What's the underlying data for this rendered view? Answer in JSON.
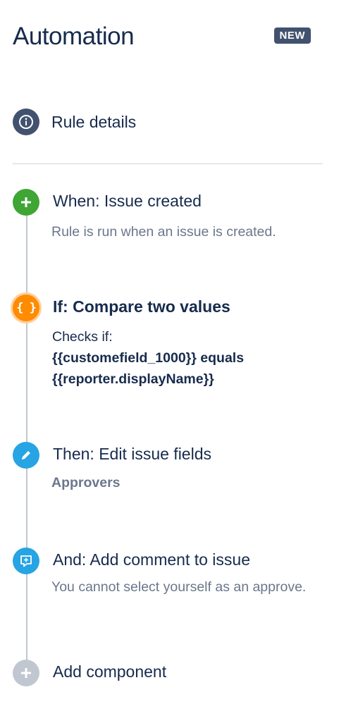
{
  "header": {
    "title": "Automation",
    "badge": "NEW"
  },
  "rule_details": {
    "label": "Rule details",
    "icon": "info-icon"
  },
  "steps": [
    {
      "title": "When: Issue created",
      "description": "Rule is run when an issue is created.",
      "icon": "plus-icon",
      "color": "#3fa535"
    },
    {
      "title": "If: Compare two values",
      "line1": "Checks if:",
      "line2": "{{customefield_1000}} equals",
      "line3": "{{reporter.displayName}}",
      "icon": "braces-icon",
      "color": "#ff8b00"
    },
    {
      "title": "Then: Edit issue fields",
      "description": "Approvers",
      "icon": "pencil-icon",
      "color": "#26a4e3"
    },
    {
      "title": "And: Add comment to issue",
      "description": "You cannot select yourself as an approve.",
      "icon": "comment-add-icon",
      "color": "#26a4e3"
    },
    {
      "title": "Add component",
      "icon": "plus-icon",
      "color": "#c1c7d0"
    }
  ]
}
